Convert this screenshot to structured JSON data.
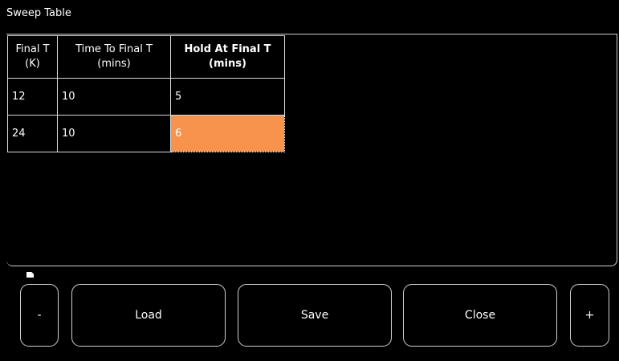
{
  "window": {
    "title": "Sweep Table"
  },
  "table": {
    "headers": [
      {
        "line1": "Final T",
        "line2": "(K)"
      },
      {
        "line1": "Time To Final T",
        "line2": "(mins)"
      },
      {
        "line1": "Hold At Final T",
        "line2": "(mins)"
      }
    ],
    "rows": [
      {
        "final_t": "12",
        "time_to_final_t": "10",
        "hold_at_final_t": "5"
      },
      {
        "final_t": "24",
        "time_to_final_t": "10",
        "hold_at_final_t": "6"
      }
    ],
    "selected_cell_color": "#f7934c"
  },
  "buttons": {
    "minus_label": "-",
    "load_label": "Load",
    "save_label": "Save",
    "close_label": "Close",
    "plus_label": "+"
  }
}
